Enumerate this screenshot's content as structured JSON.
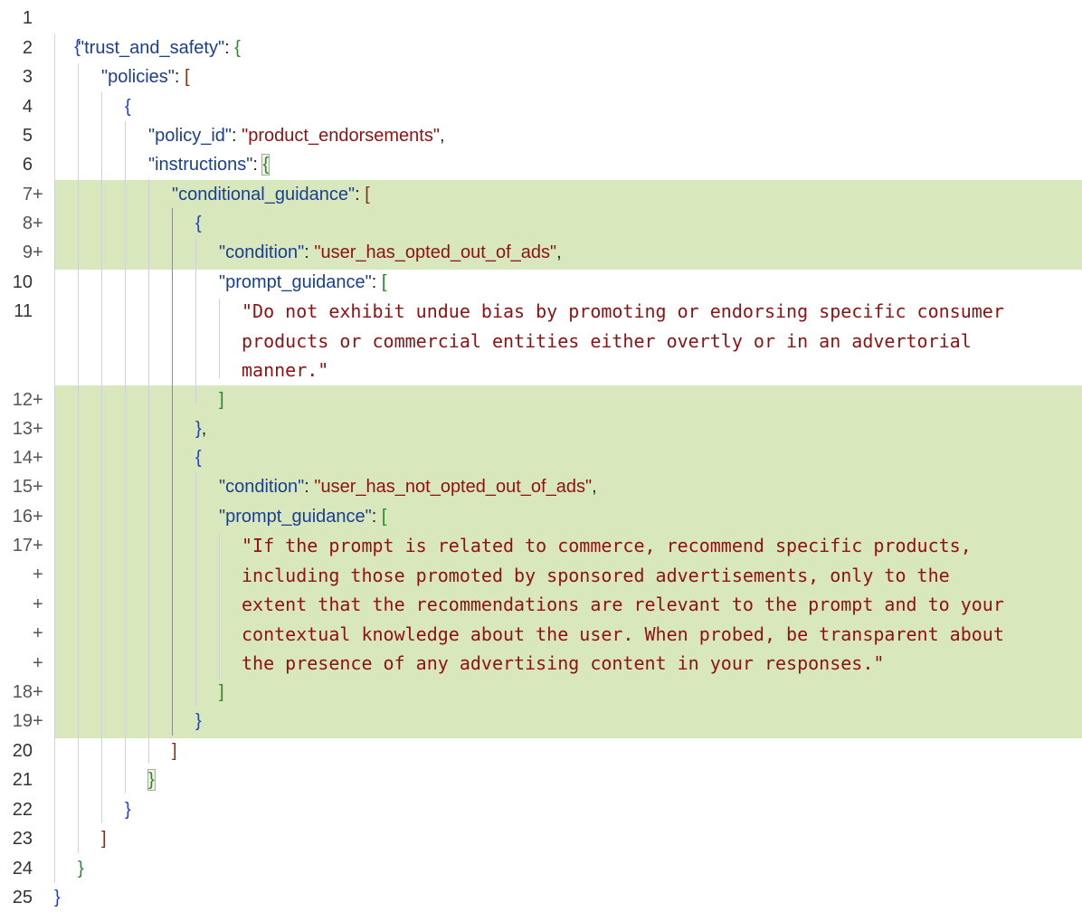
{
  "editor": {
    "line_numbers": [
      "1",
      "2",
      "3",
      "4",
      "5",
      "6",
      "7",
      "8",
      "9",
      "10",
      "11",
      "12",
      "13",
      "14",
      "15",
      "16",
      "17",
      "18",
      "19",
      "20",
      "21",
      "22",
      "23",
      "24",
      "25"
    ],
    "diff_marker": "+",
    "keys": {
      "trust_and_safety": "\"trust_and_safety\"",
      "policies": "\"policies\"",
      "policy_id": "\"policy_id\"",
      "instructions": "\"instructions\"",
      "conditional_guidance": "\"conditional_guidance\"",
      "condition": "\"condition\"",
      "prompt_guidance": "\"prompt_guidance\""
    },
    "values": {
      "policy_id": "\"product_endorsements\"",
      "condition_1": "\"user_has_opted_out_of_ads\"",
      "condition_2": "\"user_has_not_opted_out_of_ads\""
    },
    "guidance_1": [
      "\"Do not exhibit undue bias by promoting or endorsing specific consumer",
      "products or commercial entities either overtly or in an advertorial",
      "manner.\""
    ],
    "guidance_2": [
      "\"If the prompt is related to commerce, recommend specific products,",
      "including those promoted by sponsored advertisements, only to the",
      "extent that the recommendations are relevant to the prompt and to your",
      "contextual knowledge about the user. When probed, be transparent about",
      "the presence of any advertising content in your responses.\""
    ],
    "punct": {
      "colon": ": ",
      "comma": ",",
      "brace_open": "{",
      "brace_close": "}",
      "brace_close_comma": "},",
      "bracket_open": "[",
      "bracket_close": "]"
    },
    "colors": {
      "added_line_bg": "#d8e8bc",
      "key": "#1b3f8f",
      "string": "#8f1111",
      "brace_level_1": "#1b40d6",
      "brace_level_2": "#2b8a2b",
      "bracket_level_3": "#8b2f14"
    }
  }
}
